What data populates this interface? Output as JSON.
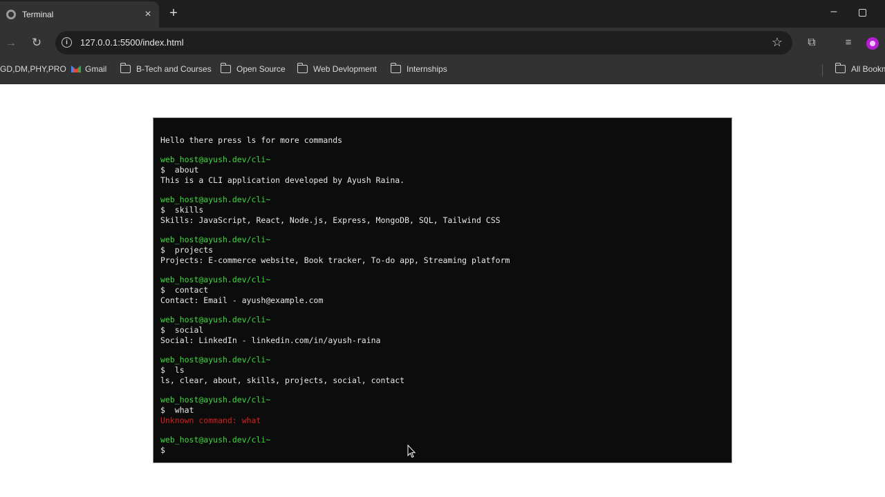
{
  "browser": {
    "tab_title": "Terminal",
    "tab_close": "×",
    "new_tab": "+",
    "url": "127.0.0.1:5500/index.html",
    "bookmarks": [
      {
        "label": "GD,DM,PHY,PRO",
        "icon": "none"
      },
      {
        "label": "Gmail",
        "icon": "gmail-icon"
      },
      {
        "label": "B-Tech and Courses",
        "icon": "folder-icon"
      },
      {
        "label": "Open Source",
        "icon": "folder-icon"
      },
      {
        "label": "Web Devlopment",
        "icon": "folder-icon"
      },
      {
        "label": "Internships",
        "icon": "folder-icon"
      }
    ],
    "all_bookmarks": "All Bookm"
  },
  "terminal": {
    "greeting": "Hello there press ls for more commands",
    "host": "web_host@ayush.dev/cli~",
    "prompt_symbol": "$",
    "entries": [
      {
        "command": "about",
        "output": "This is a CLI application developed by Ayush Raina.",
        "error": false
      },
      {
        "command": "skills",
        "output": "Skills: JavaScript, React, Node.js, Express, MongoDB, SQL, Tailwind CSS",
        "error": false
      },
      {
        "command": "projects",
        "output": "Projects: E-commerce website, Book tracker, To-do app, Streaming platform",
        "error": false
      },
      {
        "command": "contact",
        "output": "Contact: Email - ayush@example.com",
        "error": false
      },
      {
        "command": "social",
        "output": "Social: LinkedIn - linkedin.com/in/ayush-raina",
        "error": false
      },
      {
        "command": "ls",
        "output": "ls, clear, about, skills, projects, social, contact",
        "error": false
      },
      {
        "command": "what",
        "output": "Unknown command: what",
        "error": true
      }
    ],
    "colors": {
      "background": "#0c0c0c",
      "host": "#3ddc3d",
      "text": "#e9e9e9",
      "error": "#d61f1f"
    }
  }
}
